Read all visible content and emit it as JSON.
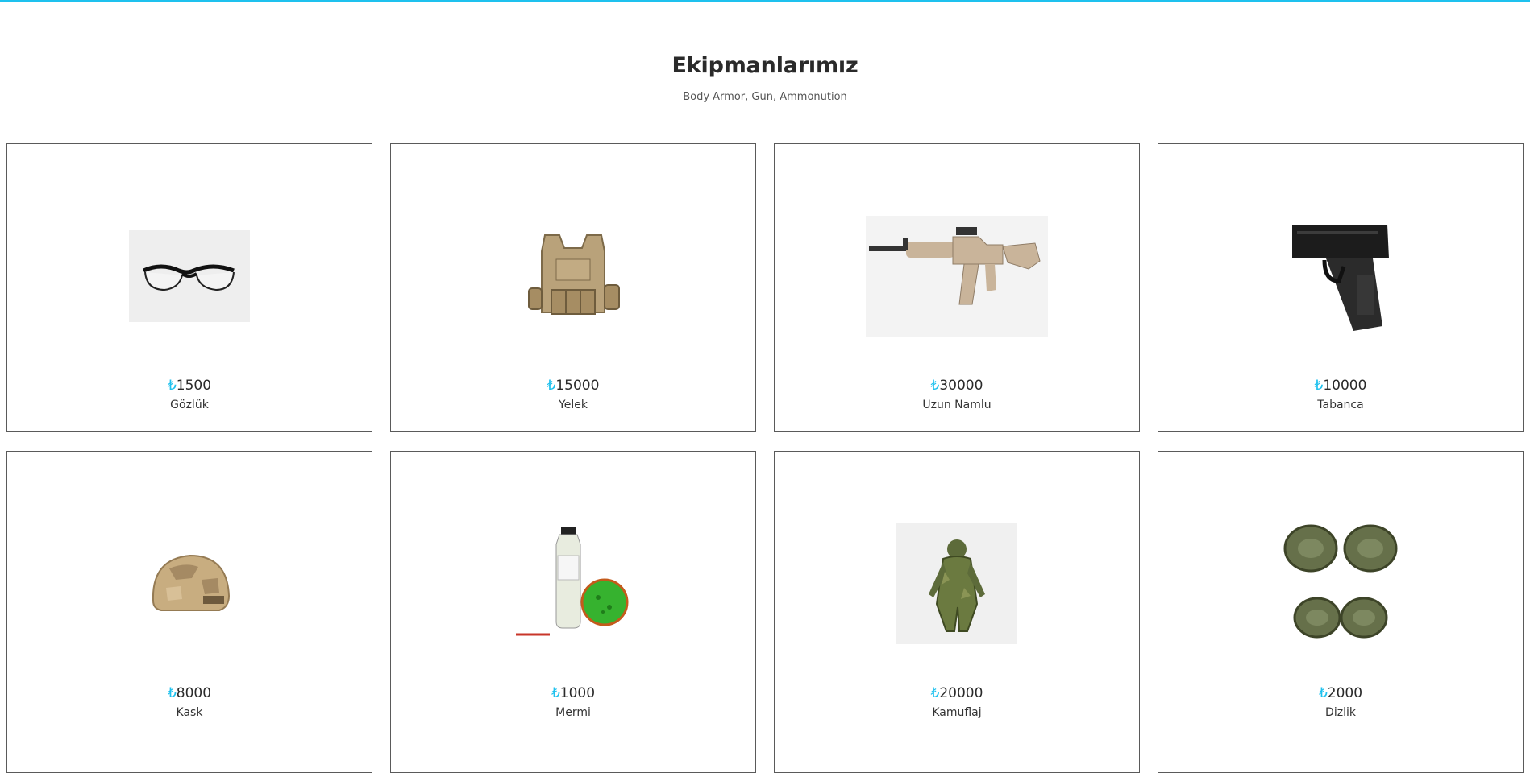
{
  "theme": {
    "accent": "#1ec1ee",
    "border": "#5a5a5a"
  },
  "section": {
    "title": "Ekipmanlarımız",
    "subtitle": "Body Armor, Gun, Ammonution"
  },
  "products": [
    {
      "currency": "₺",
      "price": "1500",
      "name": "Gözlük",
      "icon": "safety-glasses-icon"
    },
    {
      "currency": "₺",
      "price": "15000",
      "name": "Yelek",
      "icon": "tactical-vest-icon"
    },
    {
      "currency": "₺",
      "price": "30000",
      "name": "Uzun Namlu",
      "icon": "rifle-icon"
    },
    {
      "currency": "₺",
      "price": "10000",
      "name": "Tabanca",
      "icon": "pistol-icon"
    },
    {
      "currency": "₺",
      "price": "8000",
      "name": "Kask",
      "icon": "helmet-icon"
    },
    {
      "currency": "₺",
      "price": "1000",
      "name": "Mermi",
      "icon": "ammo-bottle-icon"
    },
    {
      "currency": "₺",
      "price": "20000",
      "name": "Kamuflaj",
      "icon": "ghillie-suit-icon"
    },
    {
      "currency": "₺",
      "price": "2000",
      "name": "Dizlik",
      "icon": "knee-pads-icon"
    }
  ]
}
